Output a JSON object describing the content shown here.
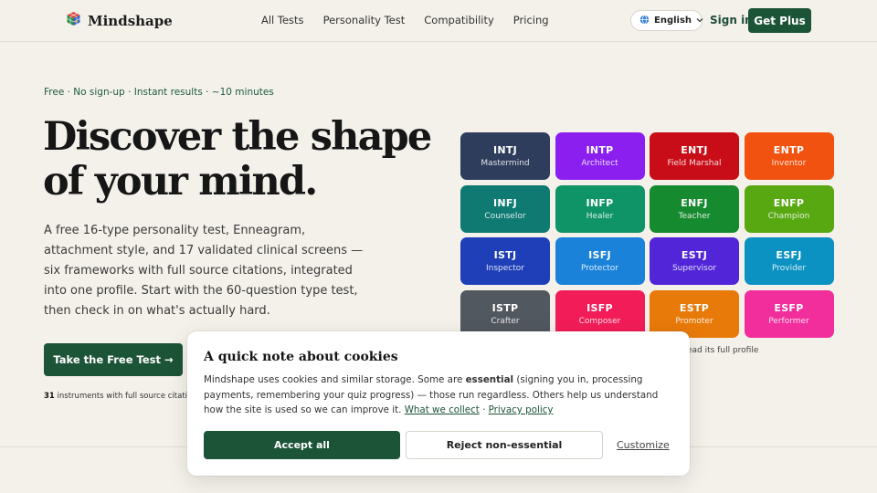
{
  "header": {
    "brand": "Mindshape",
    "nav": [
      "All Tests",
      "Personality Test",
      "Compatibility",
      "Pricing"
    ],
    "language": "English",
    "signin": "Sign in",
    "get_plus": "Get Plus"
  },
  "hero": {
    "tagline": "Free · No sign-up · Instant results · ~10 minutes",
    "headline": "Discover the shape of your mind.",
    "lede": "A free 16-type personality test, Enneagram, attachment style, and 17 validated clinical screens — six frameworks with full source citations, integrated into one profile. Start with the 60-question type test, then check in on what's actually hard.",
    "cta": "Take the Free Test →",
    "instruments_count": "31",
    "instruments_text": " instruments with full source citations",
    "grid_hint": "ead its full profile"
  },
  "types": [
    {
      "code": "INTJ",
      "name": "Mastermind",
      "color": "#2e3d5c"
    },
    {
      "code": "INTP",
      "name": "Architect",
      "color": "#8a1ff0"
    },
    {
      "code": "ENTJ",
      "name": "Field Marshal",
      "color": "#c80d18"
    },
    {
      "code": "ENTP",
      "name": "Inventor",
      "color": "#f2520f"
    },
    {
      "code": "INFJ",
      "name": "Counselor",
      "color": "#0f7a72"
    },
    {
      "code": "INFP",
      "name": "Healer",
      "color": "#0e9466"
    },
    {
      "code": "ENFJ",
      "name": "Teacher",
      "color": "#168a2e"
    },
    {
      "code": "ENFP",
      "name": "Champion",
      "color": "#58a812"
    },
    {
      "code": "ISTJ",
      "name": "Inspector",
      "color": "#1e3fb8"
    },
    {
      "code": "ISFJ",
      "name": "Protector",
      "color": "#1a82d8"
    },
    {
      "code": "ESTJ",
      "name": "Supervisor",
      "color": "#5226d8"
    },
    {
      "code": "ESFJ",
      "name": "Provider",
      "color": "#0c92c2"
    },
    {
      "code": "ISTP",
      "name": "Crafter",
      "color": "#525860"
    },
    {
      "code": "ISFP",
      "name": "Composer",
      "color": "#f21c58"
    },
    {
      "code": "ESTP",
      "name": "Promoter",
      "color": "#e87a0a"
    },
    {
      "code": "ESFP",
      "name": "Performer",
      "color": "#f22e9c"
    }
  ],
  "cookie": {
    "title": "A quick note about cookies",
    "body_1": "Mindshape uses cookies and similar storage. Some are ",
    "body_bold": "essential",
    "body_2": " (signing you in, processing payments, remembering your quiz progress) — those run regardless. Others help us understand how the site is used so we can improve it. ",
    "link_collect": "What we collect",
    "sep": " · ",
    "link_privacy": "Privacy policy",
    "accept": "Accept all",
    "reject": "Reject non-essential",
    "customize": "Customize"
  },
  "colors": {
    "accent": "#1c5438",
    "background": "#f4f1ea"
  }
}
